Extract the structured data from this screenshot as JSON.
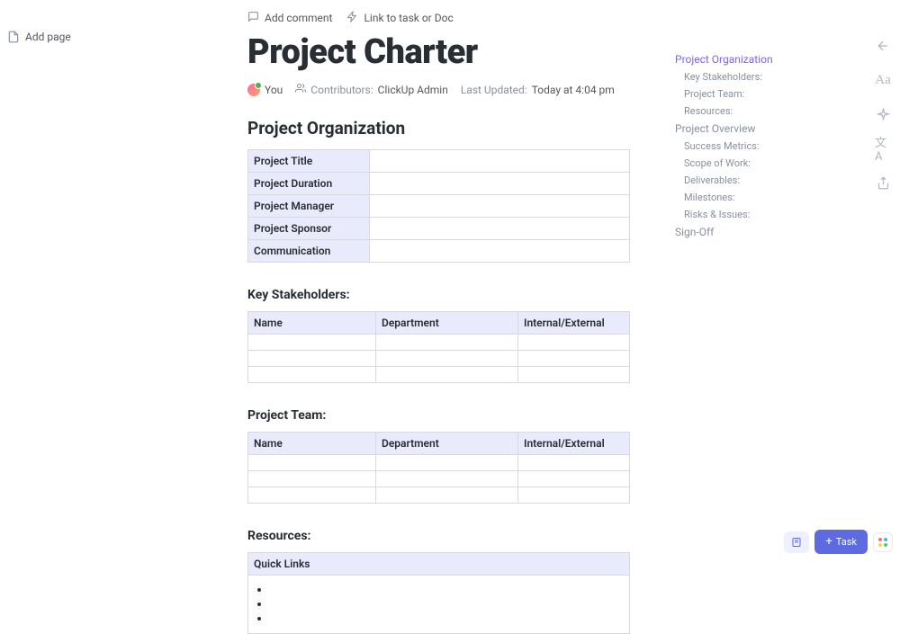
{
  "toolbar": {
    "addPage": "Add page",
    "addComment": "Add comment",
    "linkToTask": "Link to task or Doc"
  },
  "doc": {
    "title": "Project Charter"
  },
  "meta": {
    "you": "You",
    "contributorsLabel": "Contributors:",
    "contributorsValue": "ClickUp Admin",
    "lastUpdatedLabel": "Last Updated:",
    "lastUpdatedValue": "Today at 4:04 pm"
  },
  "sections": {
    "orgHeading": "Project Organization",
    "stakeholdersHeading": "Key Stakeholders:",
    "teamHeading": "Project Team:",
    "resourcesHeading": "Resources:"
  },
  "orgTable": {
    "r1": "Project Title",
    "r2": "Project Duration",
    "r3": "Project Manager",
    "r4": "Project Sponsor",
    "r5": "Communication"
  },
  "threeColHeaders": {
    "c1": "Name",
    "c2": "Department",
    "c3": "Internal/External"
  },
  "resources": {
    "quickLinks": "Quick Links"
  },
  "outline": {
    "i1": "Project Organization",
    "i2": "Key Stakeholders:",
    "i3": "Project Team:",
    "i4": "Resources:",
    "i5": "Project Overview",
    "i6": "Success Metrics:",
    "i7": "Scope of Work:",
    "i8": "Deliverables:",
    "i9": "Milestones:",
    "i10": "Risks & Issues:",
    "i11": "Sign-Off"
  },
  "bottom": {
    "task": "Task"
  }
}
